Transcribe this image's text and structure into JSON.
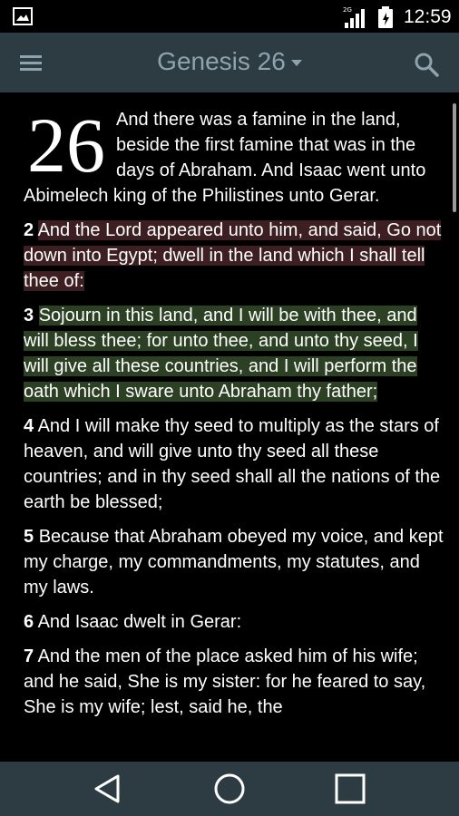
{
  "status_bar": {
    "network_label": "2G",
    "time": "12:59"
  },
  "app_bar": {
    "title": "Genesis 26"
  },
  "chapter": {
    "number": "26",
    "first_verse": "And there was a famine in the land, beside the first famine that was in the days of Abraham. And Isaac went unto Abimelech king of the Philistines unto Gerar.",
    "verses": [
      {
        "num": "2",
        "text": "And the Lord appeared unto him, and said, Go not down into Egypt; dwell in the land which I shall tell thee of:",
        "highlight": "#3d1f22"
      },
      {
        "num": "3",
        "text": "Sojourn in this land, and I will be with thee, and will bless thee; for unto thee, and unto thy seed, I will give all these countries, and I will perform the oath which I sware unto Abraham thy father;",
        "highlight": "#2c4024"
      },
      {
        "num": "4",
        "text": "And I will make thy seed to multiply as the stars of heaven, and will give unto thy seed all these countries; and in thy seed shall all the nations of the earth be blessed;",
        "highlight": ""
      },
      {
        "num": "5",
        "text": "Because that Abraham obeyed my voice, and kept my charge, my commandments, my statutes, and my laws.",
        "highlight": ""
      },
      {
        "num": "6",
        "text": "And Isaac dwelt in Gerar:",
        "highlight": ""
      },
      {
        "num": "7",
        "text": "And the men of the place asked him of his wife; and he said, She is my sister: for he feared to say, She is my wife; lest, said he, the",
        "highlight": ""
      }
    ]
  },
  "colors": {
    "app_bar": "#2c3c42",
    "title": "#8ea3ad",
    "background": "#000000",
    "highlight_red": "#3d1f22",
    "highlight_green": "#2c4024"
  },
  "icons": {
    "status_left": "gallery-icon",
    "signal": "signal-icon",
    "battery": "battery-icon",
    "menu": "hamburger-menu-icon",
    "search": "search-icon",
    "back": "back-triangle-icon",
    "home": "home-circle-icon",
    "recents": "recents-square-icon"
  }
}
